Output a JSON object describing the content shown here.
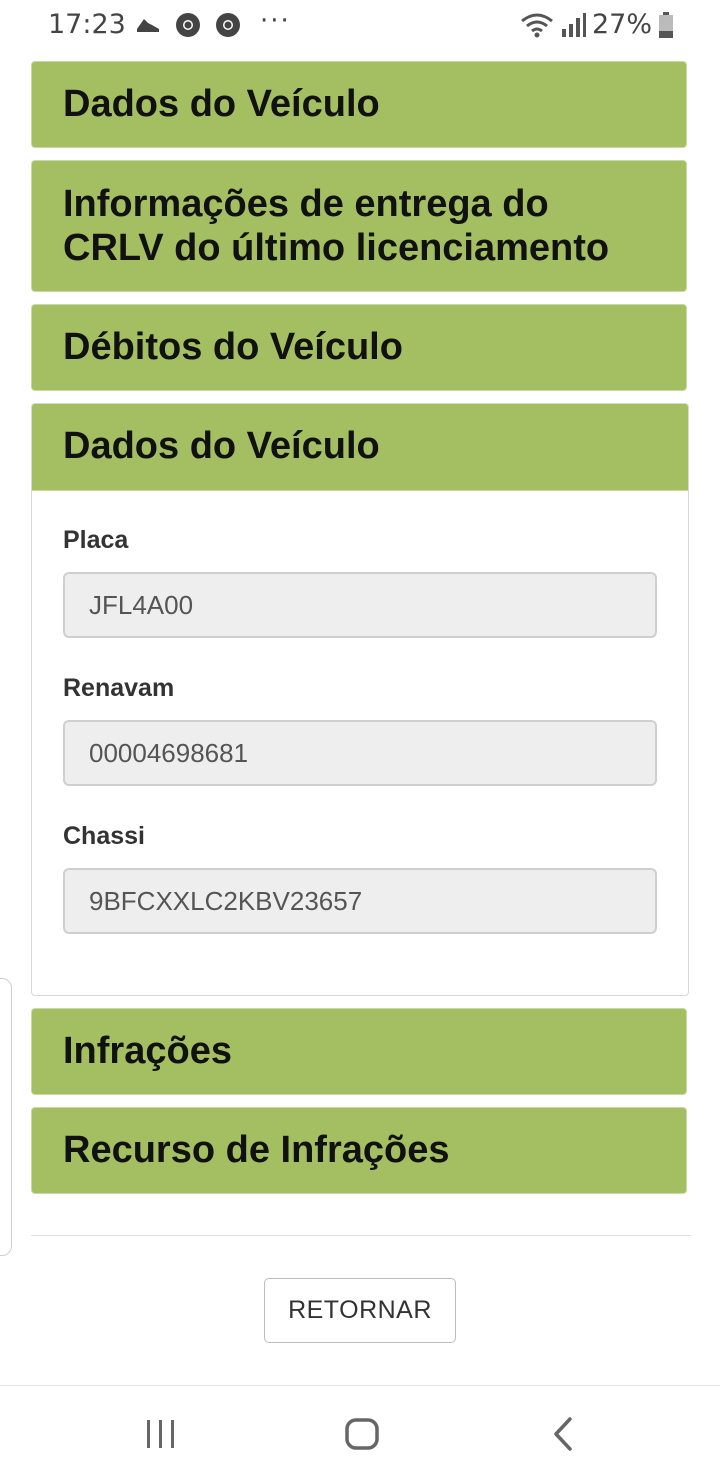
{
  "status_bar": {
    "time": "17:23",
    "dots": "···",
    "battery": "27%",
    "icons_left": [
      "running-shoe-icon",
      "chrome-icon",
      "chrome-icon"
    ],
    "icons_right": [
      "wifi-icon",
      "signal-icon",
      "battery-icon"
    ]
  },
  "panels": {
    "p1_title": "Dados do Veículo",
    "p2_title_line1": "Informações de entrega do",
    "p2_title_line2": "CRLV do último licenciamento",
    "p3_title": "Débitos do Veículo",
    "p4_title": "Dados do Veículo",
    "p5_title": "Infrações",
    "p6_title": "Recurso de Infrações"
  },
  "vehicle": {
    "placa_label": "Placa",
    "placa_value": "JFL4A00",
    "renavam_label": "Renavam",
    "renavam_value": "00004698681",
    "chassi_label": "Chassi",
    "chassi_value": "9BFCXXLC2KBV23657"
  },
  "actions": {
    "return_label": "RETORNAR"
  },
  "nav": {
    "buttons": [
      "recent-apps-icon",
      "home-icon",
      "back-icon"
    ]
  },
  "colors": {
    "panel_green": "#a4bf61",
    "input_bg": "#eeeeee"
  }
}
